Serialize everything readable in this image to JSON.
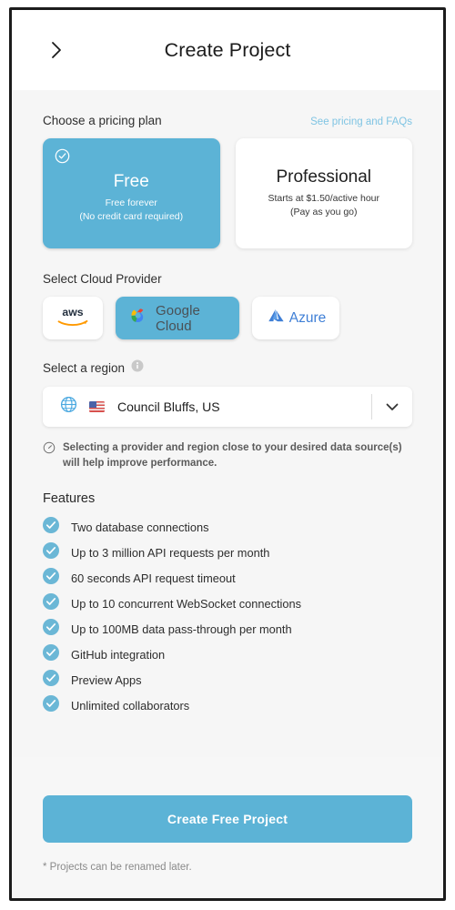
{
  "header": {
    "title": "Create Project",
    "back_icon": "chevron-right-icon"
  },
  "pricing": {
    "label": "Choose a pricing plan",
    "link": "See pricing and FAQs",
    "plans": [
      {
        "name": "Free",
        "line1": "Free forever",
        "line2": "(No credit card required)",
        "selected": true,
        "check_icon": "check-circle-icon"
      },
      {
        "name": "Professional",
        "line1": "Starts at $1.50/active hour",
        "line2": "(Pay as you go)",
        "selected": false
      }
    ]
  },
  "provider": {
    "label": "Select Cloud Provider",
    "options": [
      {
        "id": "aws",
        "label": "aws",
        "selected": false
      },
      {
        "id": "gcp",
        "label": "Google Cloud",
        "selected": true
      },
      {
        "id": "azure",
        "label": "Azure",
        "selected": false
      }
    ]
  },
  "region": {
    "label": "Select a region",
    "info_icon": "info-icon",
    "globe_icon": "globe-icon",
    "flag": "us-flag",
    "value": "Council Bluffs, US",
    "caret_icon": "chevron-down-icon",
    "note_icon": "speedometer-icon",
    "note": "Selecting a provider and region close to your desired data source(s) will help improve performance."
  },
  "features": {
    "title": "Features",
    "items": [
      "Two database connections",
      "Up to 3 million API requests per month",
      "60 seconds API request timeout",
      "Up to 10 concurrent WebSocket connections",
      "Up to 100MB data pass-through per month",
      "GitHub integration",
      "Preview Apps",
      "Unlimited collaborators"
    ]
  },
  "footer": {
    "cta": "Create Free Project",
    "footnote": "* Projects can be renamed later."
  },
  "colors": {
    "accent": "#5cb3d6",
    "link": "#7fc4e3",
    "page_bg": "#f6f6f6",
    "azure_blue": "#3f7fd6"
  }
}
